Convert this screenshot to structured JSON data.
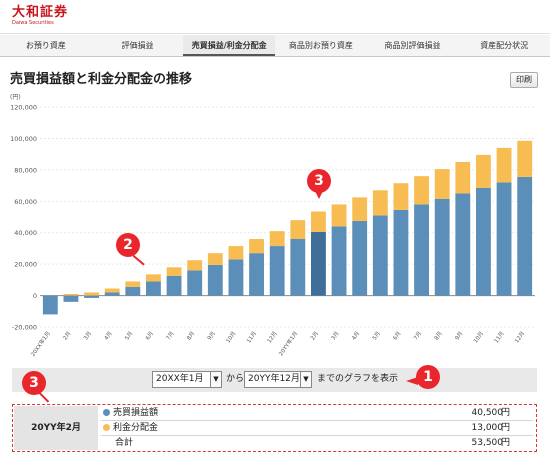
{
  "header": {
    "logo_main": "大和証券",
    "logo_sub": "Daiwa Securities"
  },
  "tabs": [
    {
      "label": "お預り資産",
      "active": false
    },
    {
      "label": "評価損益",
      "active": false
    },
    {
      "label": "売買損益/利金分配金",
      "active": true
    },
    {
      "label": "商品別お預り資産",
      "active": false
    },
    {
      "label": "商品別評価損益",
      "active": false
    },
    {
      "label": "資産配分状況",
      "active": false
    }
  ],
  "page": {
    "title": "売買損益額と利金分配金の推移",
    "print_label": "印刷"
  },
  "chart_data": {
    "type": "bar",
    "stacked": true,
    "unit_label": "(円)",
    "ylim": [
      -20000,
      120000
    ],
    "yticks": [
      "120,000",
      "100,000",
      "80,000",
      "60,000",
      "40,000",
      "20,000",
      "0",
      "-20,000"
    ],
    "categories": [
      "20XX年1月",
      "2月",
      "3月",
      "4月",
      "5月",
      "6月",
      "7月",
      "8月",
      "9月",
      "10月",
      "11月",
      "12月",
      "20YY年1月",
      "2月",
      "3月",
      "4月",
      "5月",
      "6月",
      "7月",
      "8月",
      "9月",
      "10月",
      "11月",
      "12月"
    ],
    "series": [
      {
        "name": "売買損益額",
        "color": "#5b8fba",
        "values": [
          -12000,
          -4000,
          -1500,
          2000,
          5500,
          9000,
          12500,
          16000,
          19500,
          23000,
          27000,
          31500,
          36000,
          40500,
          44000,
          47500,
          51000,
          54500,
          58000,
          61500,
          65000,
          68500,
          72000,
          75500
        ]
      },
      {
        "name": "利金分配金",
        "color": "#f8bd52",
        "values": [
          0,
          1000,
          2000,
          2500,
          3500,
          4500,
          5500,
          6500,
          7500,
          8500,
          9000,
          9500,
          12000,
          13000,
          14000,
          15000,
          16000,
          17000,
          18000,
          19000,
          20000,
          21000,
          22000,
          23000
        ]
      }
    ],
    "highlight_index": 13,
    "highlight_color": "#3f6f99",
    "grid": true,
    "legend": "none"
  },
  "controls": {
    "from_value": "20XX年1月",
    "from_label": "から",
    "to_value": "20YY年12月",
    "to_label": "までのグラフを表示"
  },
  "markers": {
    "m1": "1",
    "m2": "2",
    "m3_chart": "3",
    "m3_summary": "3"
  },
  "summary": {
    "month": "20YY年2月",
    "rows": [
      {
        "label": "売買損益額",
        "value": "40,500",
        "unit": "円",
        "dot_color": "#5b8fba"
      },
      {
        "label": "利金分配金",
        "value": "13,000",
        "unit": "円",
        "dot_color": "#f8bd52"
      },
      {
        "label": "合計",
        "value": "53,500",
        "unit": "円",
        "dot_color": ""
      }
    ]
  }
}
